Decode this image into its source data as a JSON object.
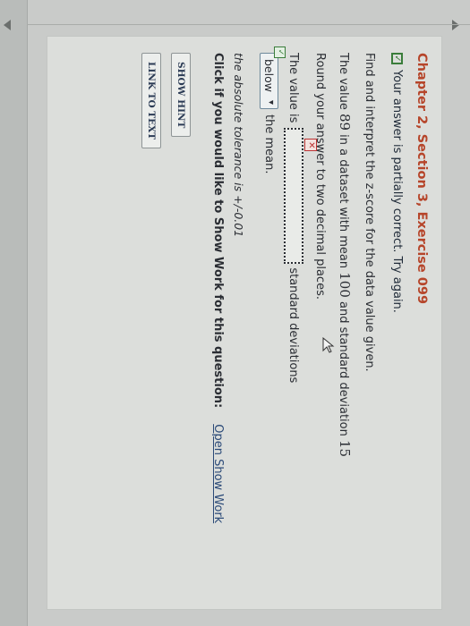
{
  "exercise": {
    "title": "Chapter 2, Section 3, Exercise 099",
    "status_text": "Your answer is partially correct.  Try again.",
    "instruction": "Find and interpret the z-score for the data value given.",
    "question": {
      "prefix": "The value ",
      "value": "89",
      "middle": " in a dataset with mean ",
      "mean": "100",
      "middle2": " and standard deviation ",
      "sd": "15"
    },
    "round_instruction": "Round your answer to two decimal places.",
    "answer_prefix": "The value is",
    "answer_value": "",
    "answer_error_badge": "✕",
    "answer_suffix": "standard deviations",
    "relation_select": "below",
    "relation_suffix": "the mean.",
    "tolerance": "the absolute tolerance is +/-0.01",
    "show_work_question": "Click if you would like to Show Work for this question:",
    "show_work_link": "Open Show Work"
  },
  "buttons": {
    "show_hint": "SHOW HINT",
    "link_to_text": "LINK TO TEXT"
  },
  "colors": {
    "title": "#b6452a",
    "correct": "#3a7d3a",
    "incorrect": "#b33333",
    "link": "#2b4a78"
  }
}
